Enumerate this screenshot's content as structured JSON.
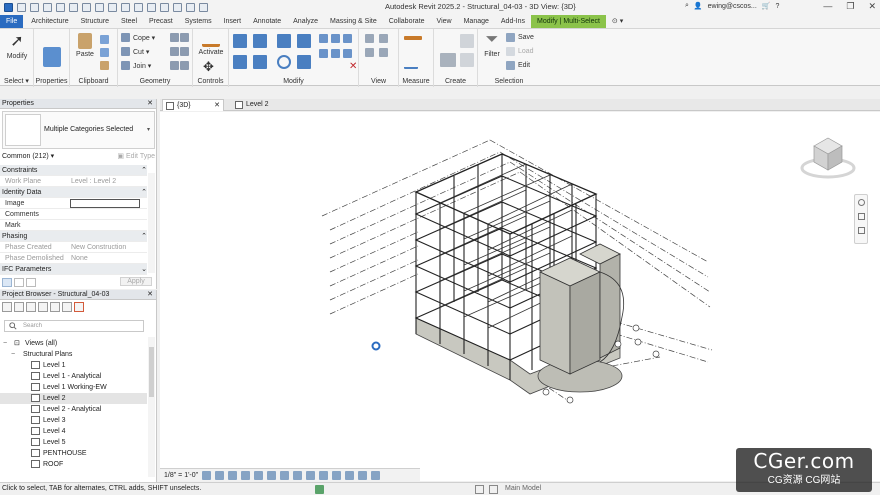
{
  "app": {
    "window_title": "Autodesk Revit 2025.2 - Structural_04-03 - 3D View: {3D}",
    "user": "ewing@cscos..."
  },
  "tabs": [
    "File",
    "Architecture",
    "Structure",
    "Steel",
    "Precast",
    "Systems",
    "Insert",
    "Annotate",
    "Analyze",
    "Massing & Site",
    "Collaborate",
    "View",
    "Manage",
    "Add-Ins",
    "Modify | Multi-Select"
  ],
  "ribbon": {
    "select": {
      "modify_label": "Modify",
      "panel_label": "Select ▾"
    },
    "properties": {
      "panel_label": "Properties"
    },
    "clipboard": {
      "paste_label": "Paste",
      "panel_label": "Clipboard"
    },
    "geometry": {
      "cope_label": "Cope ▾",
      "cut_label": "Cut ▾",
      "join_label": "Join ▾",
      "panel_label": "Geometry"
    },
    "controls": {
      "activate_label": "Activate",
      "panel_label": "Controls"
    },
    "modify": {
      "panel_label": "Modify"
    },
    "view": {
      "panel_label": "View"
    },
    "measure": {
      "panel_label": "Measure"
    },
    "create": {
      "panel_label": "Create"
    },
    "selection": {
      "filter_label": "Filter",
      "save_label": "Save",
      "load_label": "Load",
      "edit_label": "Edit",
      "panel_label": "Selection"
    }
  },
  "properties": {
    "title": "Properties",
    "type_name": "Multiple Categories Selected",
    "filter": "Common (212)",
    "edit_type": "Edit Type",
    "rows": [
      {
        "kind": "cat",
        "label": "Constraints"
      },
      {
        "kind": "row",
        "key": "Work Plane",
        "value": "Level : Level 2",
        "dim": true
      },
      {
        "kind": "cat",
        "label": "Identity Data"
      },
      {
        "kind": "row",
        "key": "Image",
        "value": ""
      },
      {
        "kind": "row",
        "key": "Comments",
        "value": ""
      },
      {
        "kind": "row",
        "key": "Mark",
        "value": ""
      },
      {
        "kind": "cat",
        "label": "Phasing"
      },
      {
        "kind": "row",
        "key": "Phase Created",
        "value": "New Construction",
        "dim": true
      },
      {
        "kind": "row",
        "key": "Phase Demolished",
        "value": "None",
        "dim": true
      },
      {
        "kind": "cat",
        "label": "IFC Parameters"
      }
    ],
    "apply": "Apply"
  },
  "browser": {
    "title": "Project Browser - Structural_04-03",
    "search_placeholder": "Search",
    "items": [
      {
        "label": "Views (all)",
        "level": 0,
        "exp": "−"
      },
      {
        "label": "Structural Plans",
        "level": 1,
        "exp": "−"
      },
      {
        "label": "Level 1",
        "level": 2
      },
      {
        "label": "Level 1 - Analytical",
        "level": 2
      },
      {
        "label": "Level 1 Working-EW",
        "level": 2
      },
      {
        "label": "Level 2",
        "level": 2,
        "selected": true
      },
      {
        "label": "Level 2 - Analytical",
        "level": 2
      },
      {
        "label": "Level 3",
        "level": 2
      },
      {
        "label": "Level 4",
        "level": 2
      },
      {
        "label": "Level 5",
        "level": 2
      },
      {
        "label": "PENTHOUSE",
        "level": 2
      },
      {
        "label": "ROOF",
        "level": 2
      }
    ]
  },
  "view_tabs": [
    {
      "label": "{3D}",
      "active": true
    },
    {
      "label": "Level 2",
      "active": false
    }
  ],
  "view_bar": {
    "scale": "1/8\" = 1'-0\""
  },
  "status": {
    "text": "Click to select, TAB for alternates, CTRL adds, SHIFT unselects.",
    "model": "Main Model"
  },
  "watermark": {
    "main": "CGer.com",
    "sub": "CG资源  CG网站"
  },
  "colors": {
    "file_tab": "#2a6bc0",
    "context_tab": "#8bc34a"
  }
}
